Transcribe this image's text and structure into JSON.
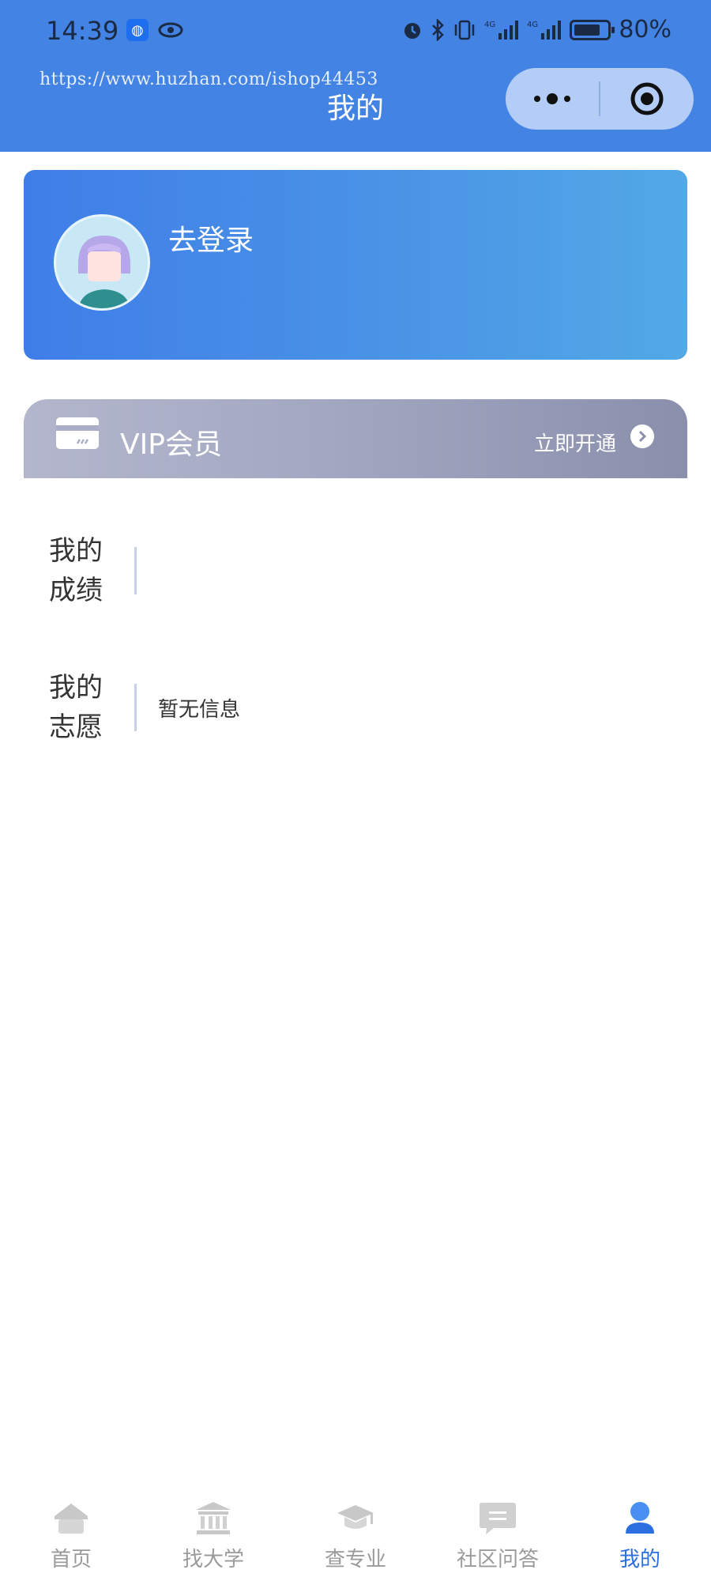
{
  "status_bar": {
    "time": "14:39",
    "battery": "80%",
    "battery_level": 0.8
  },
  "header": {
    "watermark": "https://www.huzhan.com/ishop44453",
    "title": "我的"
  },
  "login_card": {
    "login_label": "去登录"
  },
  "vip": {
    "title": "VIP会员",
    "action_label": "立即开通"
  },
  "info": {
    "scores_label": "我的成绩",
    "scores_value": "",
    "wishes_label": "我的志愿",
    "wishes_value": "暂无信息"
  },
  "tabbar": {
    "items": [
      {
        "label": "首页",
        "icon": "home-icon"
      },
      {
        "label": "找大学",
        "icon": "university-icon"
      },
      {
        "label": "查专业",
        "icon": "graduation-cap-icon"
      },
      {
        "label": "社区问答",
        "icon": "chat-icon"
      },
      {
        "label": "我的",
        "icon": "user-icon"
      }
    ],
    "active_index": 4
  },
  "colors": {
    "header": "#4283e4",
    "active_tab": "#2d6ee0",
    "inactive_tab": "#9a9a9a"
  }
}
